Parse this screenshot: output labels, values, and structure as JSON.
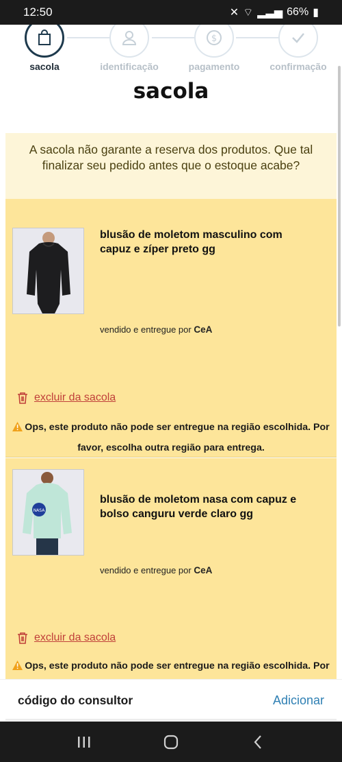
{
  "status_bar": {
    "time": "12:50",
    "battery": "66%"
  },
  "stepper": {
    "steps": [
      {
        "label": "sacola",
        "icon": "bag-icon",
        "active": true
      },
      {
        "label": "identificação",
        "icon": "user-icon",
        "active": false
      },
      {
        "label": "pagamento",
        "icon": "dollar-icon",
        "active": false
      },
      {
        "label": "confirmação",
        "icon": "check-icon",
        "active": false
      }
    ]
  },
  "page_title": "sacola",
  "notice": "A sacola não garante a reserva dos produtos. Que tal finalizar seu pedido antes que o estoque acabe?",
  "items": [
    {
      "name": "blusão de moletom masculino com capuz e zíper preto gg",
      "seller_prefix": "vendido e entregue por",
      "seller": "CeA",
      "remove_label": "excluir da sacola",
      "warning": "Ops, este produto não pode ser entregue na região escolhida. Por favor, escolha outra região para entrega.",
      "thumb_color": "#1d1d1f"
    },
    {
      "name": "blusão de moletom nasa com capuz e bolso canguru verde claro gg",
      "seller_prefix": "vendido e entregue por",
      "seller": "CeA",
      "remove_label": "excluir da sacola",
      "warning": "Ops, este produto não pode ser entregue na região escolhida. Por favor, escolha outra região para entrega.",
      "thumb_color": "#bfe6d8"
    }
  ],
  "consultant": {
    "label": "código do consultor",
    "action": "Adicionar"
  },
  "colors": {
    "item_bg": "#fde59a",
    "notice_bg": "#fdf5d8",
    "remove_red": "#c0403a",
    "link_blue": "#2e7fb3",
    "active_step": "#1e3a4d"
  }
}
